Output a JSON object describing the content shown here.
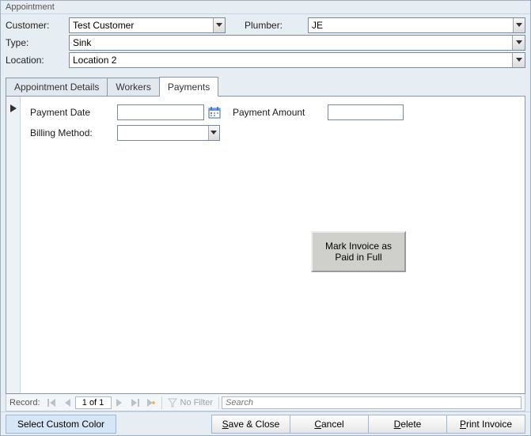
{
  "window": {
    "title": "Appointment"
  },
  "header": {
    "customer_label": "Customer:",
    "customer_value": "Test Customer",
    "plumber_label": "Plumber:",
    "plumber_value": "JE",
    "type_label": "Type:",
    "type_value": "Sink",
    "location_label": "Location:",
    "location_value": "Location 2"
  },
  "tabs": {
    "details": "Appointment Details",
    "workers": "Workers",
    "payments": "Payments",
    "active": "payments"
  },
  "payments": {
    "date_label": "Payment Date",
    "date_value": "",
    "amount_label": "Payment Amount",
    "amount_value": "",
    "billing_label": "Billing Method:",
    "billing_value": "",
    "mark_full": "Mark Invoice as\nPaid in Full"
  },
  "recnav": {
    "label": "Record:",
    "position": "1 of 1",
    "nofilter": "No Filter",
    "search_placeholder": "Search"
  },
  "footer": {
    "custom_color": "Select Custom Color",
    "save_close": "ave & Close",
    "save_close_u": "S",
    "cancel": "ancel",
    "cancel_u": "C",
    "delete": "elete",
    "delete_u": "D",
    "print": "rint Invoice",
    "print_u": "P"
  }
}
